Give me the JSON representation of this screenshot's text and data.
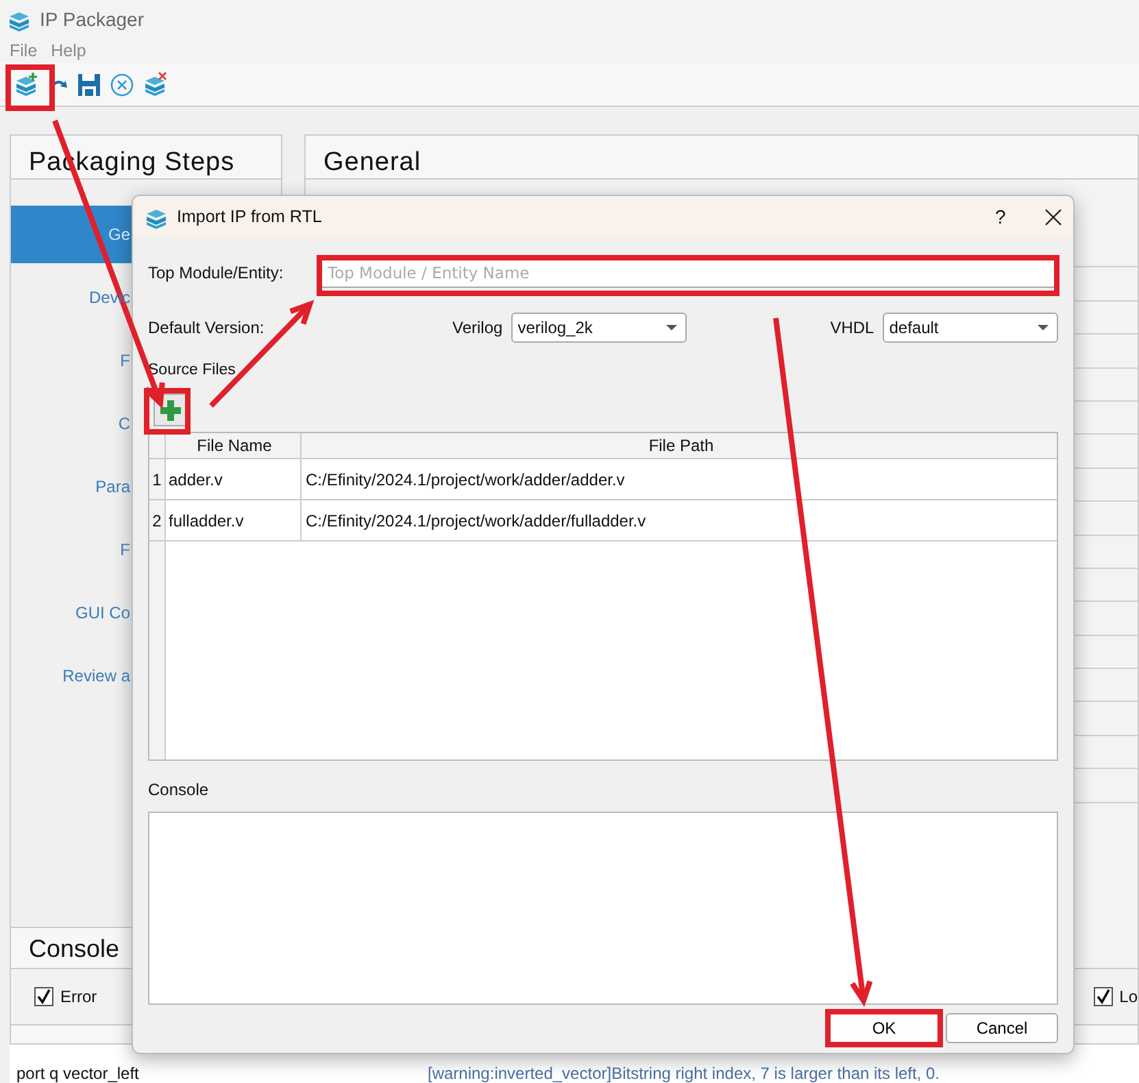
{
  "window": {
    "title": "IP Packager"
  },
  "menu": [
    "File",
    "Help"
  ],
  "steps_panel": {
    "title": "Packaging Steps",
    "items": [
      {
        "label": "Ge",
        "selected": true
      },
      {
        "label": "Devic",
        "selected": false
      },
      {
        "label": "F",
        "selected": false
      },
      {
        "label": "C",
        "selected": false
      },
      {
        "label": "Para",
        "selected": false
      },
      {
        "label": "F",
        "selected": false
      },
      {
        "label": "GUI Co",
        "selected": false
      },
      {
        "label": "Review a",
        "selected": false
      }
    ]
  },
  "general_panel": {
    "title": "General"
  },
  "console_panel": {
    "title": "Console",
    "filters": [
      {
        "label": "Error",
        "checked": true
      },
      {
        "label": "Lo",
        "checked": true
      }
    ],
    "lines": [
      {
        "column_1": "port q vector_left",
        "column_2": "[warning:inverted_vector]Bitstring right index, 7 is larger than its left, 0."
      }
    ]
  },
  "dialog": {
    "title": "Import IP from RTL",
    "help": "?",
    "top_module": {
      "label": "Top Module/Entity:",
      "placeholder": "Top Module / Entity Name"
    },
    "default_version_label": "Default Version:",
    "verilog": {
      "label": "Verilog",
      "value": "verilog_2k"
    },
    "vhdl": {
      "label": "VHDL",
      "value": "default"
    },
    "source_files_label": "Source Files",
    "table": {
      "columns": [
        "File Name",
        "File Path"
      ],
      "rows": [
        {
          "index": "1",
          "file_name": "adder.v",
          "file_path": "C:/Efinity/2024.1/project/work/adder/adder.v"
        },
        {
          "index": "2",
          "file_name": "fulladder.v",
          "file_path": "C:/Efinity/2024.1/project/work/adder/fulladder.v"
        }
      ]
    },
    "console_label": "Console",
    "buttons": [
      "OK",
      "Cancel"
    ]
  }
}
